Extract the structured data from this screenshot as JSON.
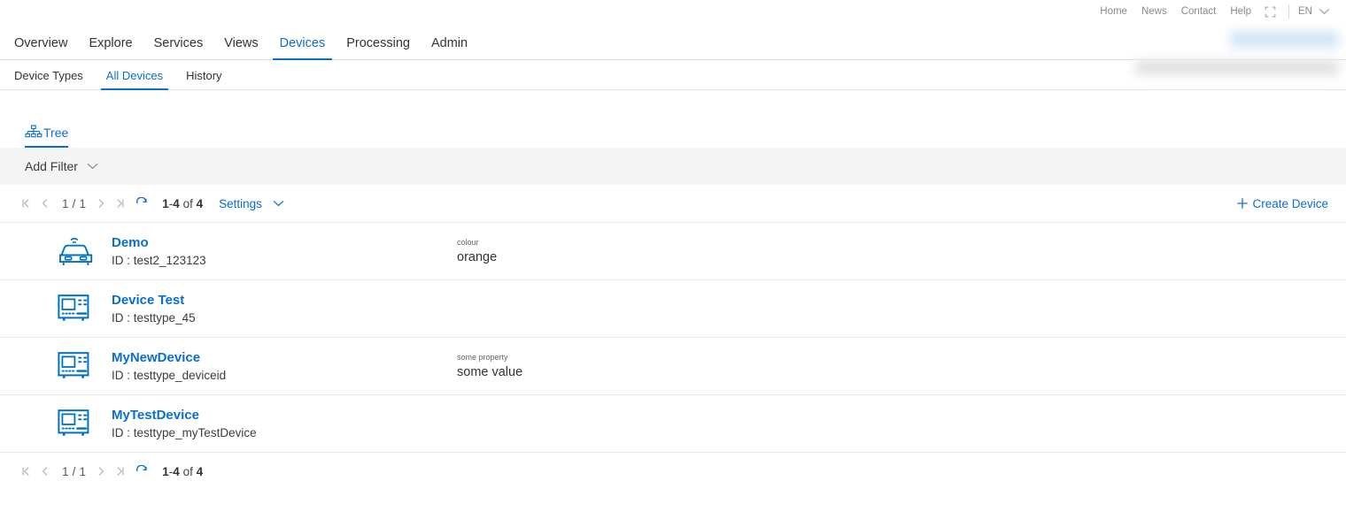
{
  "utility_bar": {
    "links": [
      {
        "label": "Home"
      },
      {
        "label": "News"
      },
      {
        "label": "Contact"
      },
      {
        "label": "Help"
      }
    ],
    "fullscreen_icon": "fullscreen-icon",
    "language": "EN",
    "language_chevron": "chevron-down-icon"
  },
  "main_nav": {
    "items": [
      {
        "label": "Overview",
        "active": false
      },
      {
        "label": "Explore",
        "active": false
      },
      {
        "label": "Services",
        "active": false
      },
      {
        "label": "Views",
        "active": false
      },
      {
        "label": "Devices",
        "active": true
      },
      {
        "label": "Processing",
        "active": false
      },
      {
        "label": "Admin",
        "active": false
      }
    ]
  },
  "sub_nav": {
    "items": [
      {
        "label": "Device Types",
        "active": false
      },
      {
        "label": "All Devices",
        "active": true
      },
      {
        "label": "History",
        "active": false
      }
    ]
  },
  "view_tabs": {
    "items": [
      {
        "label": "Tree",
        "icon": "hierarchy-tree-icon",
        "active": true
      }
    ]
  },
  "filter_bar": {
    "add_filter_label": "Add Filter",
    "chevron_icon": "chevron-down-icon"
  },
  "pager": {
    "first_icon": "page-first-icon",
    "prev_icon": "page-prev-icon",
    "page_indicator": "1 / 1",
    "next_icon": "page-next-icon",
    "last_icon": "page-last-icon",
    "refresh_icon": "refresh-icon",
    "range_from": "1",
    "range_dash": "-",
    "range_to": "4",
    "range_of": "of",
    "range_total": "4",
    "settings_label": "Settings",
    "settings_chevron_icon": "chevron-down-icon"
  },
  "create_device": {
    "label": "Create Device",
    "icon": "plus-icon"
  },
  "devices": [
    {
      "icon": "connected-car-icon",
      "name": "Demo",
      "id_label": "ID :",
      "id_value": "test2_123123",
      "property_key": "colour",
      "property_value": "orange"
    },
    {
      "icon": "device-machine-icon",
      "name": "Device Test",
      "id_label": "ID :",
      "id_value": "testtype_45",
      "property_key": "",
      "property_value": ""
    },
    {
      "icon": "device-machine-icon",
      "name": "MyNewDevice",
      "id_label": "ID :",
      "id_value": "testtype_deviceid",
      "property_key": "some property",
      "property_value": "some value"
    },
    {
      "icon": "device-machine-icon",
      "name": "MyTestDevice",
      "id_label": "ID :",
      "id_value": "testtype_myTestDevice",
      "property_key": "",
      "property_value": ""
    }
  ],
  "colors": {
    "accent_blue": "#0a6ed1",
    "icon_blue": "#0070c0",
    "text_dark": "#333333",
    "muted_gray": "#8a8a8a",
    "filter_bar_bg": "#f4f4f4",
    "border": "#e8e8e8"
  }
}
